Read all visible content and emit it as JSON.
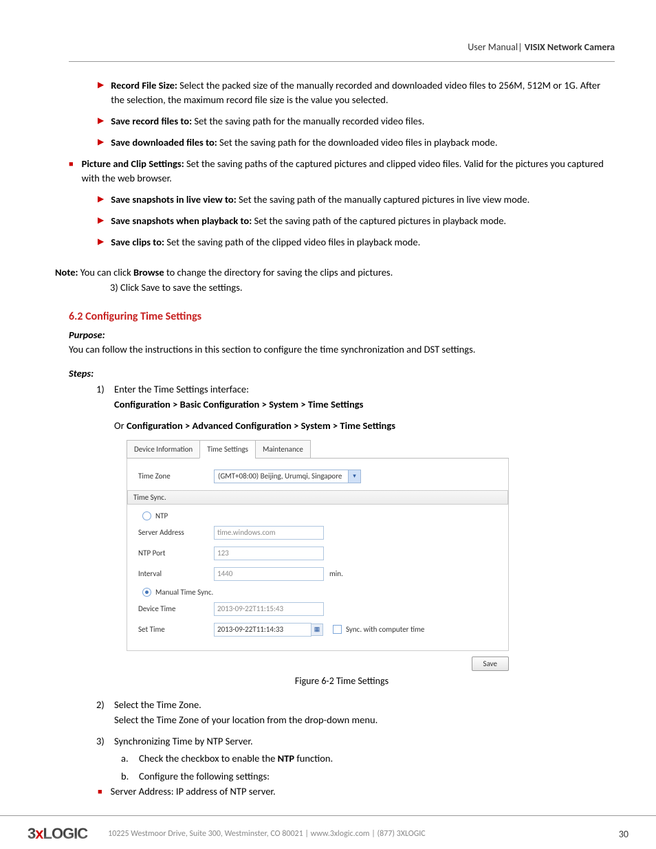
{
  "header": {
    "left": "User Manual",
    "sep": "|",
    "right": "VISIX Network Camera"
  },
  "topSubBullets": [
    {
      "label": "Record File Size:",
      "text": " Select the packed size of the manually recorded and downloaded video files to 256M, 512M or 1G. After the selection, the maximum record file size is the value you selected."
    },
    {
      "label": "Save record files to:",
      "text": " Set the saving path for the manually recorded video files."
    },
    {
      "label": "Save downloaded files to:",
      "text": " Set the saving path for the downloaded video files in playback mode."
    }
  ],
  "mainBullet": {
    "label": "Picture and Clip Settings:",
    "text": " Set the saving paths of the captured pictures and clipped video files. Valid for the pictures you captured with the web browser."
  },
  "midSubBullets": [
    {
      "label": "Save snapshots in live view to:",
      "text": " Set the saving path of the manually captured pictures in live view mode."
    },
    {
      "label": "Save snapshots when playback to:",
      "text": " Set the saving path of the captured pictures in playback mode."
    },
    {
      "label": "Save clips to:",
      "text": " Set the saving path of the clipped video files in playback mode."
    }
  ],
  "note": {
    "prefix": "Note:",
    "before": " You can click ",
    "browse": "Browse",
    "after": " to change the directory for saving the clips and pictures."
  },
  "step3": "3)    Click Save to save the settings.",
  "section": {
    "num": "6.2",
    "title": " Configuring Time Settings"
  },
  "purpose": {
    "label": "Purpose:",
    "text": "You can follow the instructions in this section to configure the time synchronization and DST settings."
  },
  "stepsLabel": "Steps:",
  "steps": [
    {
      "num": "1)",
      "text": "Enter the Time Settings interface:",
      "path1": "Configuration > Basic Configuration > System > Time Settings",
      "orPrefix": "Or ",
      "path2": "Configuration > Advanced Configuration > System > Time Settings"
    },
    {
      "num": "2)",
      "text": "Select the Time Zone.",
      "line2": "Select the Time Zone of your location from the drop-down menu."
    },
    {
      "num": "3)",
      "text": "Synchronizing Time by NTP Server.",
      "sub": [
        {
          "al": "a.",
          "t": "Check the checkbox to enable the ",
          "bold": "NTP",
          "after": " function."
        },
        {
          "al": "b.",
          "t": "Configure the following settings:"
        }
      ]
    }
  ],
  "serverBullet": "Server Address: IP address of NTP server.",
  "figure": {
    "tabs": [
      "Device Information",
      "Time Settings",
      "Maintenance"
    ],
    "activeTab": 1,
    "timezoneLabel": "Time Zone",
    "timezoneValue": "(GMT+08:00) Beijing, Urumqi, Singapore",
    "syncGroup": "Time Sync.",
    "ntpLabel": "NTP",
    "serverAddrLabel": "Server Address",
    "serverAddrValue": "time.windows.com",
    "ntpPortLabel": "NTP Port",
    "ntpPortValue": "123",
    "intervalLabel": "Interval",
    "intervalValue": "1440",
    "intervalUnit": "min.",
    "manualLabel": "Manual Time Sync.",
    "deviceTimeLabel": "Device Time",
    "deviceTimeValue": "2013-09-22T11:15:43",
    "setTimeLabel": "Set Time",
    "setTimeValue": "2013-09-22T11:14:33",
    "syncCompLabel": "Sync. with computer time",
    "saveBtn": "Save",
    "caption": "Figure 6-2 Time Settings"
  },
  "footer": {
    "logo_pre": "3",
    "logo_x": "x",
    "logo_post": "LOGIC",
    "addr": "10225 Westmoor Drive, Suite 300, Westminster, CO 80021 | www.3xlogic.com | (877) 3XLOGIC",
    "page": "30"
  }
}
